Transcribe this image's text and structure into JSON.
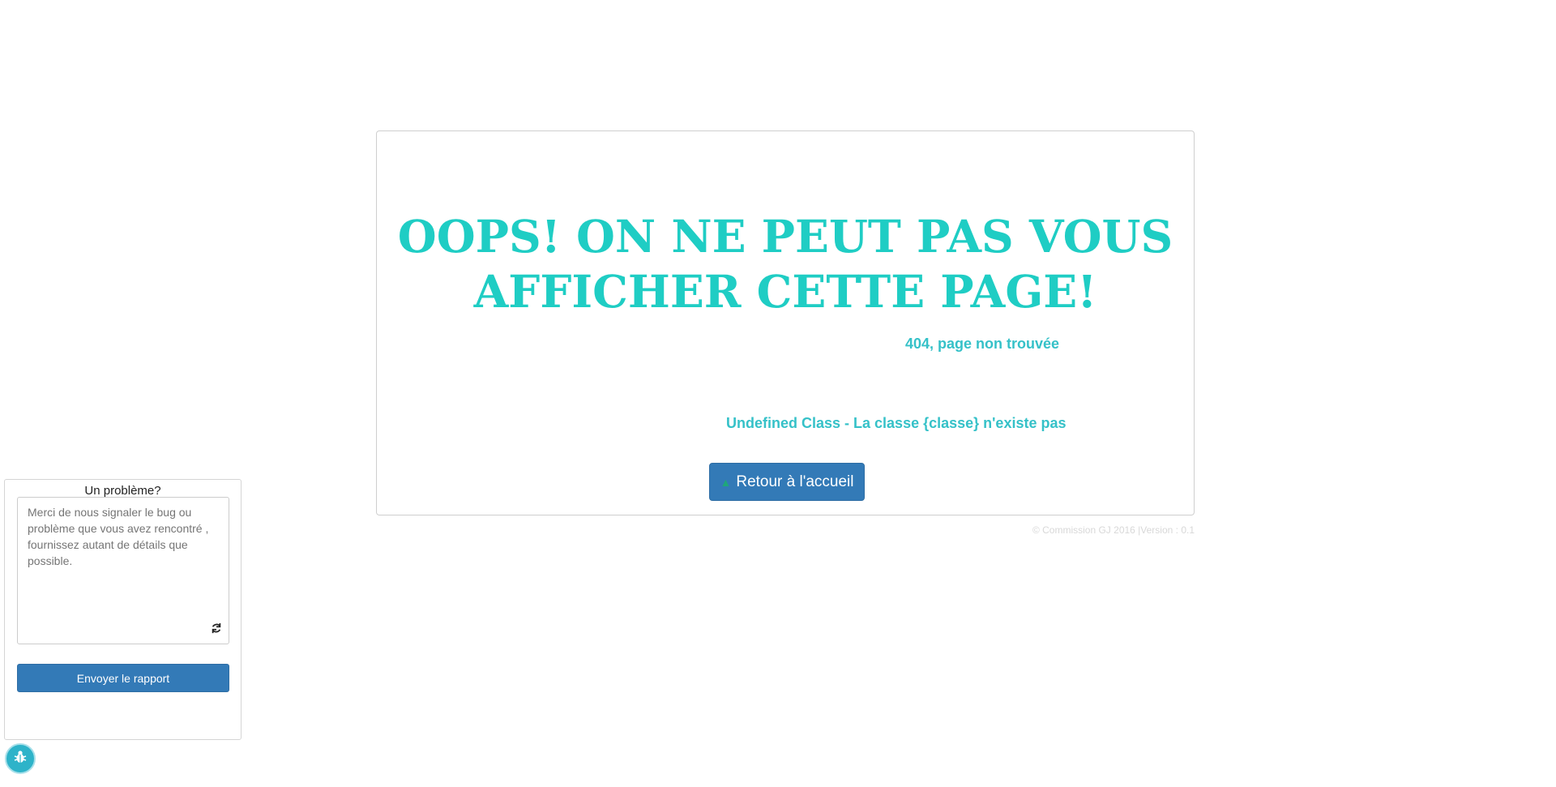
{
  "error": {
    "title": "OOPS! ON NE PEUT PAS VOUS AFFICHER CETTE PAGE!",
    "code": "404, page non trouvée",
    "detail": "Undefined Class - La classe {classe} n'existe pas",
    "home_button_label": "Retour à l'accueil",
    "home_icon": "home-icon"
  },
  "footer": {
    "text": "© Commission GJ 2016 |Version : 0.1"
  },
  "report": {
    "title": "Un problème?",
    "placeholder": "Merci de nous signaler le bug ou problème que vous avez rencontré , fournissez autant de détails que possible.",
    "send_label": "Envoyer le rapport",
    "refresh_icon": "refresh-icon",
    "bug_icon": "bug-icon"
  },
  "colors": {
    "accent": "#1fcdc4",
    "secondary_text": "#35c1c8",
    "button": "#337ab7",
    "badge": "#2eb3c9"
  }
}
